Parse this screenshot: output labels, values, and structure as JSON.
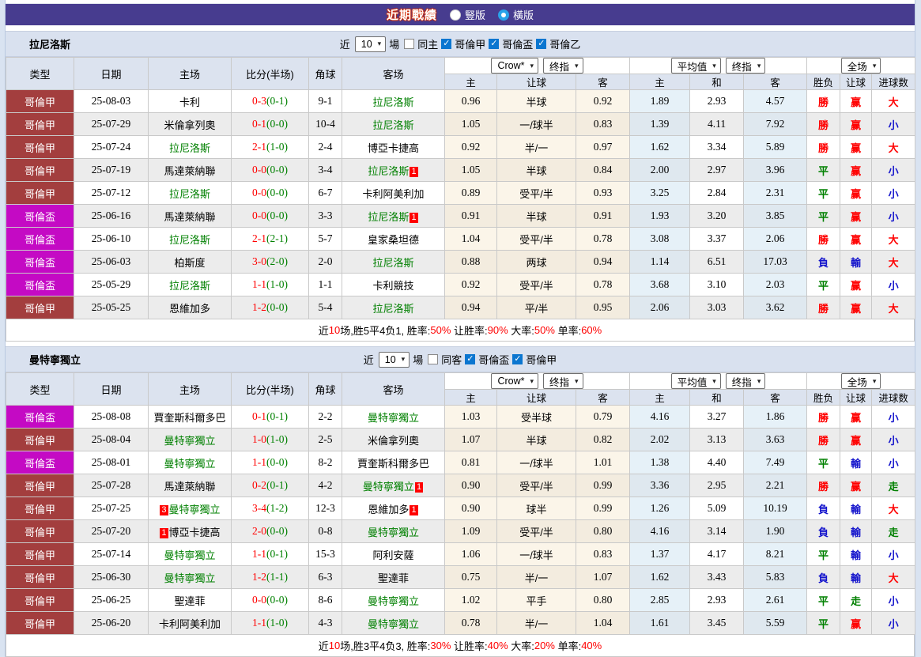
{
  "title_bar": {
    "title": "近期戰績",
    "radios": [
      {
        "label": "豎版",
        "selected": false
      },
      {
        "label": "橫版",
        "selected": true
      }
    ]
  },
  "colors": {
    "bar_purple": "#473c8f",
    "league_red": "#a33e3e",
    "league_magenta": "#c40ac4",
    "team_green": "#008000",
    "win_red": "#ff0000",
    "lose_blue": "#1414cc",
    "draw_green": "#008000",
    "check_blue": "#0b76d0"
  },
  "table_header": {
    "left_cols": [
      "类型",
      "日期",
      "主场",
      "比分(半场)",
      "角球",
      "客场"
    ],
    "handicap_dropdowns": [
      "Crow*",
      "终指"
    ],
    "euro_dropdowns": [
      "平均值",
      "终指"
    ],
    "scope_dropdown": "全场",
    "sub_cols": [
      "主",
      "让球",
      "客",
      "主",
      "和",
      "客",
      "胜负",
      "让球",
      "进球数"
    ]
  },
  "sections": [
    {
      "team": "拉尼洛斯",
      "filter": {
        "near_label": "近",
        "matches": "10",
        "field_label": "場",
        "same": {
          "label": "同主",
          "checked": false
        },
        "leagues": [
          {
            "label": "哥倫甲",
            "checked": true
          },
          {
            "label": "哥倫盃",
            "checked": true
          },
          {
            "label": "哥倫乙",
            "checked": true
          }
        ]
      },
      "rows": [
        {
          "lg": "哥倫甲",
          "lgc": "red",
          "d": "25-08-03",
          "h": {
            "n": "卡利"
          },
          "s": "0-3",
          "hf": "(0-1)",
          "cn": "9-1",
          "a": {
            "n": "拉尼洛斯",
            "g": 1
          },
          "o": [
            "0.96",
            "半球",
            "0.92"
          ],
          "e": [
            "1.89",
            "2.93",
            "4.57"
          ],
          "r": [
            [
              "勝",
              "r"
            ],
            [
              "赢",
              "r"
            ],
            [
              "大",
              "r"
            ]
          ]
        },
        {
          "lg": "哥倫甲",
          "lgc": "red",
          "d": "25-07-29",
          "h": {
            "n": "米倫拿列奧"
          },
          "s": "0-1",
          "hf": "(0-0)",
          "cn": "10-4",
          "a": {
            "n": "拉尼洛斯",
            "g": 1
          },
          "o": [
            "1.05",
            "一/球半",
            "0.83"
          ],
          "e": [
            "1.39",
            "4.11",
            "7.92"
          ],
          "r": [
            [
              "勝",
              "r"
            ],
            [
              "赢",
              "r"
            ],
            [
              "小",
              "b"
            ]
          ]
        },
        {
          "lg": "哥倫甲",
          "lgc": "red",
          "d": "25-07-24",
          "h": {
            "n": "拉尼洛斯",
            "g": 1
          },
          "s": "2-1",
          "hf": "(1-0)",
          "cn": "2-4",
          "a": {
            "n": "博亞卡捷高"
          },
          "o": [
            "0.92",
            "半/一",
            "0.97"
          ],
          "e": [
            "1.62",
            "3.34",
            "5.89"
          ],
          "r": [
            [
              "勝",
              "r"
            ],
            [
              "赢",
              "r"
            ],
            [
              "大",
              "r"
            ]
          ]
        },
        {
          "lg": "哥倫甲",
          "lgc": "red",
          "d": "25-07-19",
          "h": {
            "n": "馬達萊納聯"
          },
          "s": "0-0",
          "hf": "(0-0)",
          "cn": "3-4",
          "a": {
            "n": "拉尼洛斯",
            "g": 1,
            "suf": "1"
          },
          "o": [
            "1.05",
            "半球",
            "0.84"
          ],
          "e": [
            "2.00",
            "2.97",
            "3.96"
          ],
          "r": [
            [
              "平",
              "g"
            ],
            [
              "赢",
              "r"
            ],
            [
              "小",
              "b"
            ]
          ]
        },
        {
          "lg": "哥倫甲",
          "lgc": "red",
          "d": "25-07-12",
          "h": {
            "n": "拉尼洛斯",
            "g": 1
          },
          "s": "0-0",
          "hf": "(0-0)",
          "cn": "6-7",
          "a": {
            "n": "卡利阿美利加"
          },
          "o": [
            "0.89",
            "受平/半",
            "0.93"
          ],
          "e": [
            "3.25",
            "2.84",
            "2.31"
          ],
          "r": [
            [
              "平",
              "g"
            ],
            [
              "赢",
              "r"
            ],
            [
              "小",
              "b"
            ]
          ]
        },
        {
          "lg": "哥倫盃",
          "lgc": "magenta",
          "d": "25-06-16",
          "h": {
            "n": "馬達萊納聯"
          },
          "s": "0-0",
          "hf": "(0-0)",
          "cn": "3-3",
          "a": {
            "n": "拉尼洛斯",
            "g": 1,
            "suf": "1"
          },
          "o": [
            "0.91",
            "半球",
            "0.91"
          ],
          "e": [
            "1.93",
            "3.20",
            "3.85"
          ],
          "r": [
            [
              "平",
              "g"
            ],
            [
              "赢",
              "r"
            ],
            [
              "小",
              "b"
            ]
          ]
        },
        {
          "lg": "哥倫盃",
          "lgc": "magenta",
          "d": "25-06-10",
          "h": {
            "n": "拉尼洛斯",
            "g": 1
          },
          "s": "2-1",
          "hf": "(2-1)",
          "cn": "5-7",
          "a": {
            "n": "皇家桑坦德"
          },
          "o": [
            "1.04",
            "受平/半",
            "0.78"
          ],
          "e": [
            "3.08",
            "3.37",
            "2.06"
          ],
          "r": [
            [
              "勝",
              "r"
            ],
            [
              "赢",
              "r"
            ],
            [
              "大",
              "r"
            ]
          ]
        },
        {
          "lg": "哥倫盃",
          "lgc": "magenta",
          "d": "25-06-03",
          "h": {
            "n": "柏斯度"
          },
          "s": "3-0",
          "hf": "(2-0)",
          "cn": "2-0",
          "a": {
            "n": "拉尼洛斯",
            "g": 1
          },
          "o": [
            "0.88",
            "两球",
            "0.94"
          ],
          "e": [
            "1.14",
            "6.51",
            "17.03"
          ],
          "r": [
            [
              "負",
              "b"
            ],
            [
              "輸",
              "b"
            ],
            [
              "大",
              "r"
            ]
          ]
        },
        {
          "lg": "哥倫盃",
          "lgc": "magenta",
          "d": "25-05-29",
          "h": {
            "n": "拉尼洛斯",
            "g": 1
          },
          "s": "1-1",
          "hf": "(1-0)",
          "cn": "1-1",
          "a": {
            "n": "卡利競技"
          },
          "o": [
            "0.92",
            "受平/半",
            "0.78"
          ],
          "e": [
            "3.68",
            "3.10",
            "2.03"
          ],
          "r": [
            [
              "平",
              "g"
            ],
            [
              "赢",
              "r"
            ],
            [
              "小",
              "b"
            ]
          ]
        },
        {
          "lg": "哥倫甲",
          "lgc": "red",
          "d": "25-05-25",
          "h": {
            "n": "恩維加多"
          },
          "s": "1-2",
          "hf": "(0-0)",
          "cn": "5-4",
          "a": {
            "n": "拉尼洛斯",
            "g": 1
          },
          "o": [
            "0.94",
            "平/半",
            "0.95"
          ],
          "e": [
            "2.06",
            "3.03",
            "3.62"
          ],
          "r": [
            [
              "勝",
              "r"
            ],
            [
              "赢",
              "r"
            ],
            [
              "大",
              "r"
            ]
          ]
        }
      ],
      "summary": [
        [
          "近",
          "k"
        ],
        [
          "10",
          "r"
        ],
        [
          "场,胜5平4负1, 胜率:",
          "k"
        ],
        [
          "50%",
          "r"
        ],
        [
          " 让胜率:",
          "k"
        ],
        [
          "90%",
          "r"
        ],
        [
          " 大率:",
          "k"
        ],
        [
          "50%",
          "r"
        ],
        [
          " 单率:",
          "k"
        ],
        [
          "60%",
          "r"
        ]
      ]
    },
    {
      "team": "曼特寧獨立",
      "filter": {
        "near_label": "近",
        "matches": "10",
        "field_label": "場",
        "same": {
          "label": "同客",
          "checked": false
        },
        "leagues": [
          {
            "label": "哥倫盃",
            "checked": true
          },
          {
            "label": "哥倫甲",
            "checked": true
          }
        ]
      },
      "rows": [
        {
          "lg": "哥倫盃",
          "lgc": "magenta",
          "d": "25-08-08",
          "h": {
            "n": "賈奎斯科爾多巴"
          },
          "s": "0-1",
          "hf": "(0-1)",
          "cn": "2-2",
          "a": {
            "n": "曼特寧獨立",
            "g": 1
          },
          "o": [
            "1.03",
            "受半球",
            "0.79"
          ],
          "e": [
            "4.16",
            "3.27",
            "1.86"
          ],
          "r": [
            [
              "勝",
              "r"
            ],
            [
              "赢",
              "r"
            ],
            [
              "小",
              "b"
            ]
          ]
        },
        {
          "lg": "哥倫甲",
          "lgc": "red",
          "d": "25-08-04",
          "h": {
            "n": "曼特寧獨立",
            "g": 1
          },
          "s": "1-0",
          "hf": "(1-0)",
          "cn": "2-5",
          "a": {
            "n": "米倫拿列奧"
          },
          "o": [
            "1.07",
            "半球",
            "0.82"
          ],
          "e": [
            "2.02",
            "3.13",
            "3.63"
          ],
          "r": [
            [
              "勝",
              "r"
            ],
            [
              "赢",
              "r"
            ],
            [
              "小",
              "b"
            ]
          ]
        },
        {
          "lg": "哥倫盃",
          "lgc": "magenta",
          "d": "25-08-01",
          "h": {
            "n": "曼特寧獨立",
            "g": 1
          },
          "s": "1-1",
          "hf": "(0-0)",
          "cn": "8-2",
          "a": {
            "n": "賈奎斯科爾多巴"
          },
          "o": [
            "0.81",
            "一/球半",
            "1.01"
          ],
          "e": [
            "1.38",
            "4.40",
            "7.49"
          ],
          "r": [
            [
              "平",
              "g"
            ],
            [
              "輸",
              "b"
            ],
            [
              "小",
              "b"
            ]
          ]
        },
        {
          "lg": "哥倫甲",
          "lgc": "red",
          "d": "25-07-28",
          "h": {
            "n": "馬達萊納聯"
          },
          "s": "0-2",
          "hf": "(0-1)",
          "cn": "4-2",
          "a": {
            "n": "曼特寧獨立",
            "g": 1,
            "suf": "1"
          },
          "o": [
            "0.90",
            "受平/半",
            "0.99"
          ],
          "e": [
            "3.36",
            "2.95",
            "2.21"
          ],
          "r": [
            [
              "勝",
              "r"
            ],
            [
              "赢",
              "r"
            ],
            [
              "走",
              "g"
            ]
          ]
        },
        {
          "lg": "哥倫甲",
          "lgc": "red",
          "d": "25-07-25",
          "h": {
            "n": "曼特寧獨立",
            "g": 1,
            "pre": "3"
          },
          "s": "3-4",
          "hf": "(1-2)",
          "cn": "12-3",
          "a": {
            "n": "恩維加多",
            "suf": "1"
          },
          "o": [
            "0.90",
            "球半",
            "0.99"
          ],
          "e": [
            "1.26",
            "5.09",
            "10.19"
          ],
          "r": [
            [
              "負",
              "b"
            ],
            [
              "輸",
              "b"
            ],
            [
              "大",
              "r"
            ]
          ]
        },
        {
          "lg": "哥倫甲",
          "lgc": "red",
          "d": "25-07-20",
          "h": {
            "n": "博亞卡捷高",
            "pre": "1"
          },
          "s": "2-0",
          "hf": "(0-0)",
          "cn": "0-8",
          "a": {
            "n": "曼特寧獨立",
            "g": 1
          },
          "o": [
            "1.09",
            "受平/半",
            "0.80"
          ],
          "e": [
            "4.16",
            "3.14",
            "1.90"
          ],
          "r": [
            [
              "負",
              "b"
            ],
            [
              "輸",
              "b"
            ],
            [
              "走",
              "g"
            ]
          ]
        },
        {
          "lg": "哥倫甲",
          "lgc": "red",
          "d": "25-07-14",
          "h": {
            "n": "曼特寧獨立",
            "g": 1
          },
          "s": "1-1",
          "hf": "(0-1)",
          "cn": "15-3",
          "a": {
            "n": "阿利安薩"
          },
          "o": [
            "1.06",
            "一/球半",
            "0.83"
          ],
          "e": [
            "1.37",
            "4.17",
            "8.21"
          ],
          "r": [
            [
              "平",
              "g"
            ],
            [
              "輸",
              "b"
            ],
            [
              "小",
              "b"
            ]
          ]
        },
        {
          "lg": "哥倫甲",
          "lgc": "red",
          "d": "25-06-30",
          "h": {
            "n": "曼特寧獨立",
            "g": 1
          },
          "s": "1-2",
          "hf": "(1-1)",
          "cn": "6-3",
          "a": {
            "n": "聖達菲"
          },
          "o": [
            "0.75",
            "半/一",
            "1.07"
          ],
          "e": [
            "1.62",
            "3.43",
            "5.83"
          ],
          "r": [
            [
              "負",
              "b"
            ],
            [
              "輸",
              "b"
            ],
            [
              "大",
              "r"
            ]
          ]
        },
        {
          "lg": "哥倫甲",
          "lgc": "red",
          "d": "25-06-25",
          "h": {
            "n": "聖達菲"
          },
          "s": "0-0",
          "hf": "(0-0)",
          "cn": "8-6",
          "a": {
            "n": "曼特寧獨立",
            "g": 1
          },
          "o": [
            "1.02",
            "平手",
            "0.80"
          ],
          "e": [
            "2.85",
            "2.93",
            "2.61"
          ],
          "r": [
            [
              "平",
              "g"
            ],
            [
              "走",
              "g"
            ],
            [
              "小",
              "b"
            ]
          ]
        },
        {
          "lg": "哥倫甲",
          "lgc": "red",
          "d": "25-06-20",
          "h": {
            "n": "卡利阿美利加"
          },
          "s": "1-1",
          "hf": "(1-0)",
          "cn": "4-3",
          "a": {
            "n": "曼特寧獨立",
            "g": 1
          },
          "o": [
            "0.78",
            "半/一",
            "1.04"
          ],
          "e": [
            "1.61",
            "3.45",
            "5.59"
          ],
          "r": [
            [
              "平",
              "g"
            ],
            [
              "赢",
              "r"
            ],
            [
              "小",
              "b"
            ]
          ]
        }
      ],
      "summary": [
        [
          "近",
          "k"
        ],
        [
          "10",
          "r"
        ],
        [
          "场,胜3平4负3, 胜率:",
          "k"
        ],
        [
          "30%",
          "r"
        ],
        [
          " 让胜率:",
          "k"
        ],
        [
          "40%",
          "r"
        ],
        [
          " 大率:",
          "k"
        ],
        [
          "20%",
          "r"
        ],
        [
          " 单率:",
          "k"
        ],
        [
          "40%",
          "r"
        ]
      ]
    }
  ]
}
